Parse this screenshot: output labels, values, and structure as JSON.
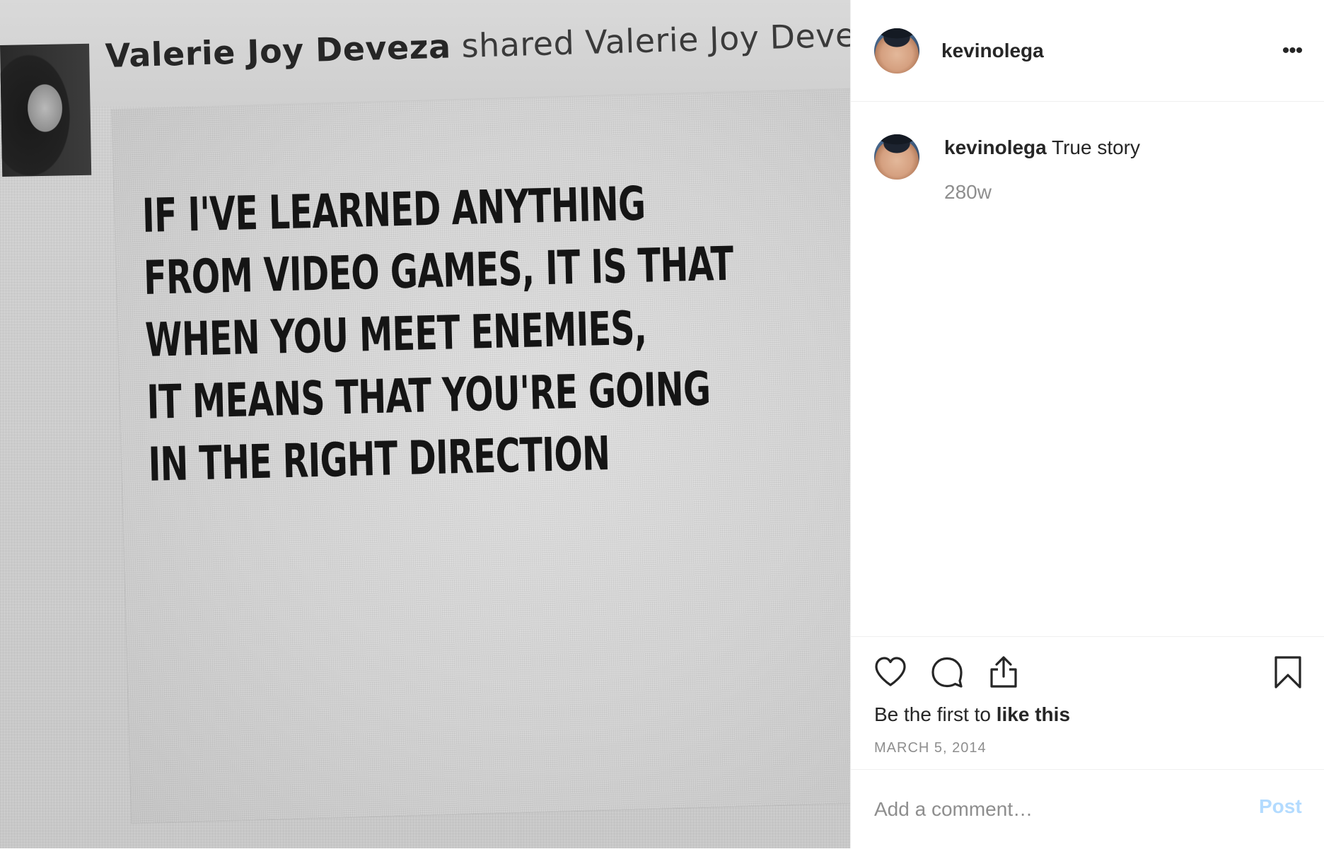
{
  "photo": {
    "header_name": "Valerie Joy Deveza",
    "header_rest": " shared Valerie Joy Deveza's p",
    "quote_lines": [
      "IF I'VE LEARNED ANYTHING",
      "FROM VIDEO GAMES, IT IS THAT",
      "WHEN YOU MEET ENEMIES,",
      "IT MEANS THAT YOU'RE GOING",
      "IN THE RIGHT DIRECTION"
    ]
  },
  "header": {
    "username": "kevinolega",
    "more_icon": "more-horizontal-icon",
    "more_glyph": "•••"
  },
  "caption": {
    "username": "kevinolega",
    "text": "True story",
    "age": "280w"
  },
  "actions": {
    "icons": [
      "heart-icon",
      "comment-icon",
      "share-icon",
      "bookmark-icon"
    ],
    "likes_prefix": "Be the first to ",
    "likes_bold": "like this",
    "date": "MARCH 5, 2014"
  },
  "comment": {
    "placeholder": "Add a comment…",
    "post_label": "Post"
  },
  "colors": {
    "text": "#262626",
    "muted": "#8e8e8e",
    "border": "#efefef",
    "post_disabled": "#b3dbff"
  }
}
